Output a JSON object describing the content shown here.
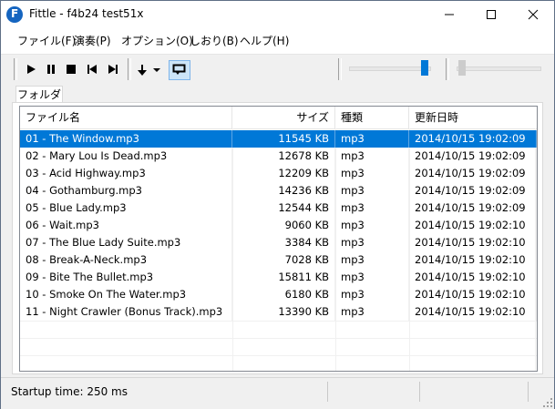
{
  "window": {
    "title": "Fittle - f4b24 test51x"
  },
  "menu": {
    "items": [
      "ファイル(F)",
      "演奏(P)",
      "オプション(O)",
      "しおり(B)",
      "ヘルプ(H)"
    ]
  },
  "toolbar": {
    "buttons": [
      "play-icon",
      "pause-icon",
      "stop-icon",
      "previous-icon",
      "next-icon",
      "download-icon",
      "dropdown-arrow-icon",
      "repeat-icon"
    ],
    "volume_level": 0.95,
    "seek_position": 0.0
  },
  "tabs": [
    "フォルダ"
  ],
  "list": {
    "columns": [
      "ファイル名",
      "サイズ",
      "種類",
      "更新日時"
    ],
    "rows": [
      [
        "01 - The Window.mp3",
        "11545 KB",
        "mp3",
        "2014/10/15 19:02:09"
      ],
      [
        "02 - Mary Lou Is Dead.mp3",
        "12678 KB",
        "mp3",
        "2014/10/15 19:02:09"
      ],
      [
        "03 - Acid Highway.mp3",
        "12209 KB",
        "mp3",
        "2014/10/15 19:02:09"
      ],
      [
        "04 - Gothamburg.mp3",
        "14236 KB",
        "mp3",
        "2014/10/15 19:02:09"
      ],
      [
        "05 - Blue Lady.mp3",
        "12544 KB",
        "mp3",
        "2014/10/15 19:02:09"
      ],
      [
        "06 - Wait.mp3",
        "9060 KB",
        "mp3",
        "2014/10/15 19:02:10"
      ],
      [
        "07 - The Blue Lady Suite.mp3",
        "3384 KB",
        "mp3",
        "2014/10/15 19:02:10"
      ],
      [
        "08 - Break-A-Neck.mp3",
        "7028 KB",
        "mp3",
        "2014/10/15 19:02:10"
      ],
      [
        "09 - Bite The Bullet.mp3",
        "15811 KB",
        "mp3",
        "2014/10/15 19:02:10"
      ],
      [
        "10 - Smoke On The Water.mp3",
        "6180 KB",
        "mp3",
        "2014/10/15 19:02:10"
      ],
      [
        "11 - Night Crawler (Bonus Track).mp3",
        "13390 KB",
        "mp3",
        "2014/10/15 19:02:10"
      ]
    ],
    "selected_index": 0
  },
  "status": {
    "text": "Startup time: 250 ms"
  },
  "colors": {
    "selection": "#0078d7",
    "accent": "#0078d7"
  }
}
